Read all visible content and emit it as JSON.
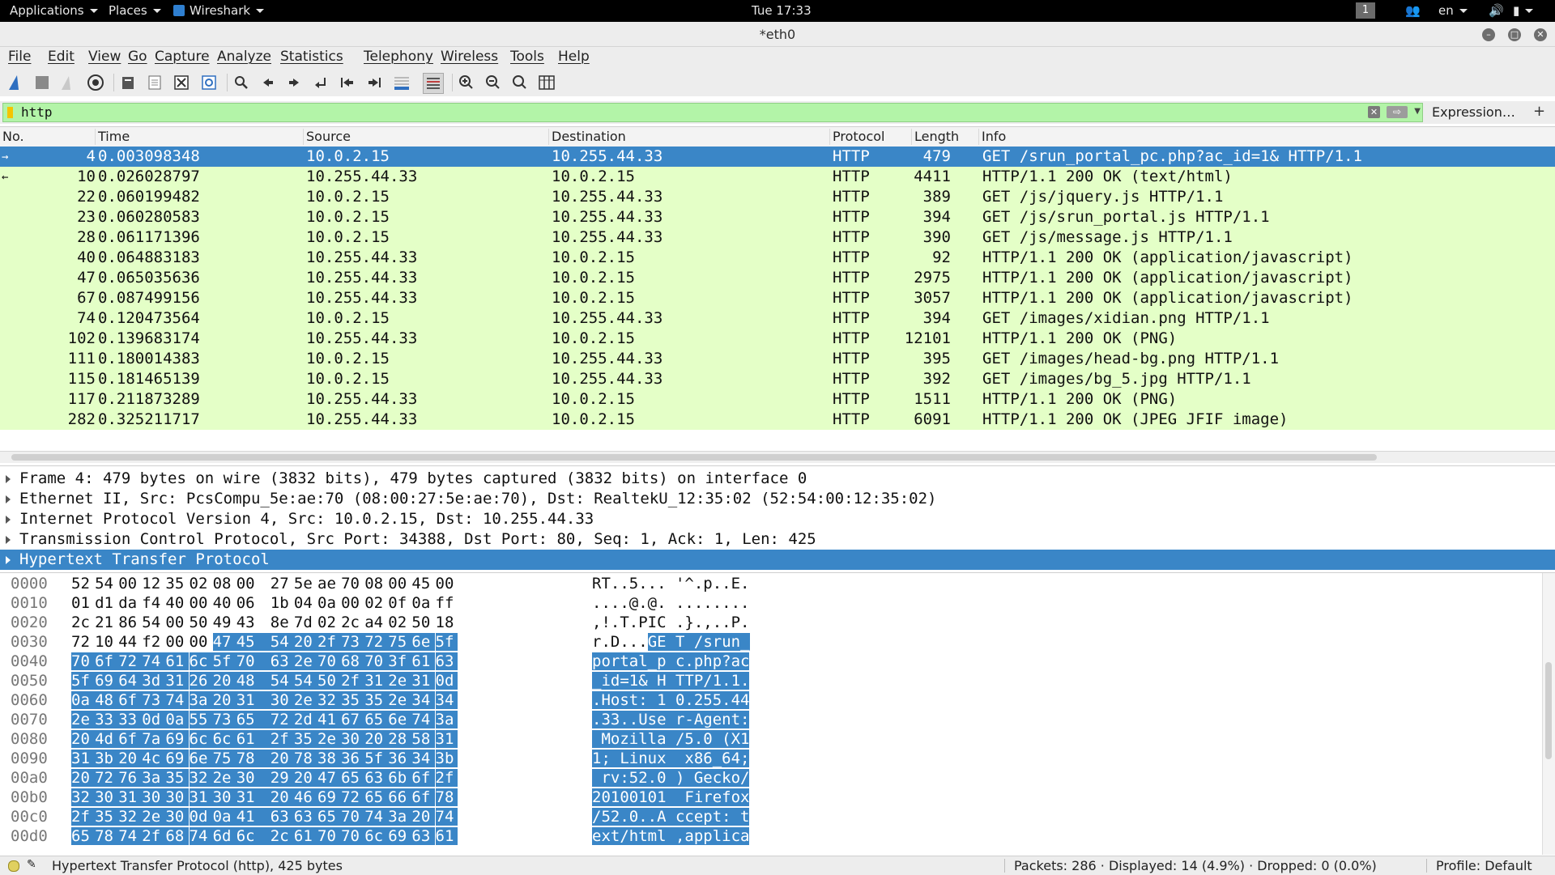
{
  "top_panel": {
    "applications": "Applications",
    "places": "Places",
    "app_name": "Wireshark",
    "clock": "Tue 17:33",
    "workspace": "1",
    "lang": "en"
  },
  "window": {
    "title": "*eth0"
  },
  "menu": [
    "File",
    "Edit",
    "View",
    "Go",
    "Capture",
    "Analyze",
    "Statistics",
    "Telephony",
    "Wireless",
    "Tools",
    "Help"
  ],
  "toolbar_icons": [
    "shark-fin-start-icon",
    "stop-icon",
    "restart-icon",
    "options-icon",
    "open-file-icon",
    "save-file-icon",
    "close-file-icon",
    "reload-icon",
    "find-packet-icon",
    "go-back-icon",
    "go-forward-icon",
    "go-to-packet-icon",
    "first-packet-icon",
    "last-packet-icon",
    "autoscroll-icon",
    "colorize-icon",
    "zoom-in-icon",
    "zoom-out-icon",
    "normal-size-icon",
    "resize-columns-icon"
  ],
  "filter": {
    "value": "http",
    "expression_label": "Expression…",
    "plus": "+"
  },
  "packet_list": {
    "columns": [
      "No.",
      "Time",
      "Source",
      "Destination",
      "Protocol",
      "Length",
      "Info"
    ],
    "rows": [
      {
        "no": "4",
        "time": "0.003098348",
        "src": "10.0.2.15",
        "dst": "10.255.44.33",
        "proto": "HTTP",
        "len": "479",
        "info": "GET /srun_portal_pc.php?ac_id=1& HTTP/1.1"
      },
      {
        "no": "10",
        "time": "0.026028797",
        "src": "10.255.44.33",
        "dst": "10.0.2.15",
        "proto": "HTTP",
        "len": "4411",
        "info": "HTTP/1.1 200 OK  (text/html)"
      },
      {
        "no": "22",
        "time": "0.060199482",
        "src": "10.0.2.15",
        "dst": "10.255.44.33",
        "proto": "HTTP",
        "len": "389",
        "info": "GET /js/jquery.js HTTP/1.1"
      },
      {
        "no": "23",
        "time": "0.060280583",
        "src": "10.0.2.15",
        "dst": "10.255.44.33",
        "proto": "HTTP",
        "len": "394",
        "info": "GET /js/srun_portal.js HTTP/1.1"
      },
      {
        "no": "28",
        "time": "0.061171396",
        "src": "10.0.2.15",
        "dst": "10.255.44.33",
        "proto": "HTTP",
        "len": "390",
        "info": "GET /js/message.js HTTP/1.1"
      },
      {
        "no": "40",
        "time": "0.064883183",
        "src": "10.255.44.33",
        "dst": "10.0.2.15",
        "proto": "HTTP",
        "len": "92",
        "info": "HTTP/1.1 200 OK  (application/javascript)"
      },
      {
        "no": "47",
        "time": "0.065035636",
        "src": "10.255.44.33",
        "dst": "10.0.2.15",
        "proto": "HTTP",
        "len": "2975",
        "info": "HTTP/1.1 200 OK  (application/javascript)"
      },
      {
        "no": "67",
        "time": "0.087499156",
        "src": "10.255.44.33",
        "dst": "10.0.2.15",
        "proto": "HTTP",
        "len": "3057",
        "info": "HTTP/1.1 200 OK  (application/javascript)"
      },
      {
        "no": "74",
        "time": "0.120473564",
        "src": "10.0.2.15",
        "dst": "10.255.44.33",
        "proto": "HTTP",
        "len": "394",
        "info": "GET /images/xidian.png HTTP/1.1"
      },
      {
        "no": "102",
        "time": "0.139683174",
        "src": "10.255.44.33",
        "dst": "10.0.2.15",
        "proto": "HTTP",
        "len": "12101",
        "info": "HTTP/1.1 200 OK  (PNG)"
      },
      {
        "no": "111",
        "time": "0.180014383",
        "src": "10.0.2.15",
        "dst": "10.255.44.33",
        "proto": "HTTP",
        "len": "395",
        "info": "GET /images/head-bg.png HTTP/1.1"
      },
      {
        "no": "115",
        "time": "0.181465139",
        "src": "10.0.2.15",
        "dst": "10.255.44.33",
        "proto": "HTTP",
        "len": "392",
        "info": "GET /images/bg_5.jpg HTTP/1.1"
      },
      {
        "no": "117",
        "time": "0.211873289",
        "src": "10.255.44.33",
        "dst": "10.0.2.15",
        "proto": "HTTP",
        "len": "1511",
        "info": "HTTP/1.1 200 OK  (PNG)"
      },
      {
        "no": "282",
        "time": "0.325211717",
        "src": "10.255.44.33",
        "dst": "10.0.2.15",
        "proto": "HTTP",
        "len": "6091",
        "info": "HTTP/1.1 200 OK  (JPEG JFIF image)"
      }
    ],
    "selected_no": "4"
  },
  "details": [
    "Frame 4: 479 bytes on wire (3832 bits), 479 bytes captured (3832 bits) on interface 0",
    "Ethernet II, Src: PcsCompu_5e:ae:70 (08:00:27:5e:ae:70), Dst: RealtekU_12:35:02 (52:54:00:12:35:02)",
    "Internet Protocol Version 4, Src: 10.0.2.15, Dst: 10.255.44.33",
    "Transmission Control Protocol, Src Port: 34388, Dst Port: 80, Seq: 1, Ack: 1, Len: 425",
    "Hypertext Transfer Protocol"
  ],
  "bytes": [
    {
      "off": "0000",
      "hex": [
        "52",
        "54",
        "00",
        "12",
        "35",
        "02",
        "08",
        "00",
        "27",
        "5e",
        "ae",
        "70",
        "08",
        "00",
        "45",
        "00"
      ],
      "ascii": "RT..5... '^.p..E."
    },
    {
      "off": "0010",
      "hex": [
        "01",
        "d1",
        "da",
        "f4",
        "40",
        "00",
        "40",
        "06",
        "1b",
        "04",
        "0a",
        "00",
        "02",
        "0f",
        "0a",
        "ff"
      ],
      "ascii": "....@.@. ........"
    },
    {
      "off": "0020",
      "hex": [
        "2c",
        "21",
        "86",
        "54",
        "00",
        "50",
        "49",
        "43",
        "8e",
        "7d",
        "02",
        "2c",
        "a4",
        "02",
        "50",
        "18"
      ],
      "ascii": ",!.T.PIC .}.,..P."
    },
    {
      "off": "0030",
      "hex": [
        "72",
        "10",
        "44",
        "f2",
        "00",
        "00",
        "47",
        "45",
        "54",
        "20",
        "2f",
        "73",
        "72",
        "75",
        "6e",
        "5f"
      ],
      "ascii": "r.D...GE T /srun_"
    },
    {
      "off": "0040",
      "hex": [
        "70",
        "6f",
        "72",
        "74",
        "61",
        "6c",
        "5f",
        "70",
        "63",
        "2e",
        "70",
        "68",
        "70",
        "3f",
        "61",
        "63"
      ],
      "ascii": "portal_p c.php?ac"
    },
    {
      "off": "0050",
      "hex": [
        "5f",
        "69",
        "64",
        "3d",
        "31",
        "26",
        "20",
        "48",
        "54",
        "54",
        "50",
        "2f",
        "31",
        "2e",
        "31",
        "0d"
      ],
      "ascii": "_id=1& H TTP/1.1."
    },
    {
      "off": "0060",
      "hex": [
        "0a",
        "48",
        "6f",
        "73",
        "74",
        "3a",
        "20",
        "31",
        "30",
        "2e",
        "32",
        "35",
        "35",
        "2e",
        "34",
        "34"
      ],
      "ascii": ".Host: 1 0.255.44"
    },
    {
      "off": "0070",
      "hex": [
        "2e",
        "33",
        "33",
        "0d",
        "0a",
        "55",
        "73",
        "65",
        "72",
        "2d",
        "41",
        "67",
        "65",
        "6e",
        "74",
        "3a"
      ],
      "ascii": ".33..Use r-Agent:"
    },
    {
      "off": "0080",
      "hex": [
        "20",
        "4d",
        "6f",
        "7a",
        "69",
        "6c",
        "6c",
        "61",
        "2f",
        "35",
        "2e",
        "30",
        "20",
        "28",
        "58",
        "31"
      ],
      "ascii": " Mozilla /5.0 (X1"
    },
    {
      "off": "0090",
      "hex": [
        "31",
        "3b",
        "20",
        "4c",
        "69",
        "6e",
        "75",
        "78",
        "20",
        "78",
        "38",
        "36",
        "5f",
        "36",
        "34",
        "3b"
      ],
      "ascii": "1; Linux  x86_64;"
    },
    {
      "off": "00a0",
      "hex": [
        "20",
        "72",
        "76",
        "3a",
        "35",
        "32",
        "2e",
        "30",
        "29",
        "20",
        "47",
        "65",
        "63",
        "6b",
        "6f",
        "2f"
      ],
      "ascii": " rv:52.0 ) Gecko/"
    },
    {
      "off": "00b0",
      "hex": [
        "32",
        "30",
        "31",
        "30",
        "30",
        "31",
        "30",
        "31",
        "20",
        "46",
        "69",
        "72",
        "65",
        "66",
        "6f",
        "78"
      ],
      "ascii": "20100101  Firefox"
    },
    {
      "off": "00c0",
      "hex": [
        "2f",
        "35",
        "32",
        "2e",
        "30",
        "0d",
        "0a",
        "41",
        "63",
        "63",
        "65",
        "70",
        "74",
        "3a",
        "20",
        "74"
      ],
      "ascii": "/52.0..A ccept: t"
    },
    {
      "off": "00d0",
      "hex": [
        "65",
        "78",
        "74",
        "2f",
        "68",
        "74",
        "6d",
        "6c",
        "2c",
        "61",
        "70",
        "70",
        "6c",
        "69",
        "63",
        "61"
      ],
      "ascii": "ext/html ,applica"
    }
  ],
  "highlight_start_byte": 54,
  "status": {
    "selected_field": "Hypertext Transfer Protocol (http), 425 bytes",
    "packets": "Packets: 286 · Displayed: 14 (4.9%) · Dropped: 0 (0.0%)",
    "profile": "Profile: Default"
  },
  "colors": {
    "accent": "#3a86c7",
    "row_bg": "#e4ffc7",
    "filter_ok": "#b3f4a8"
  }
}
